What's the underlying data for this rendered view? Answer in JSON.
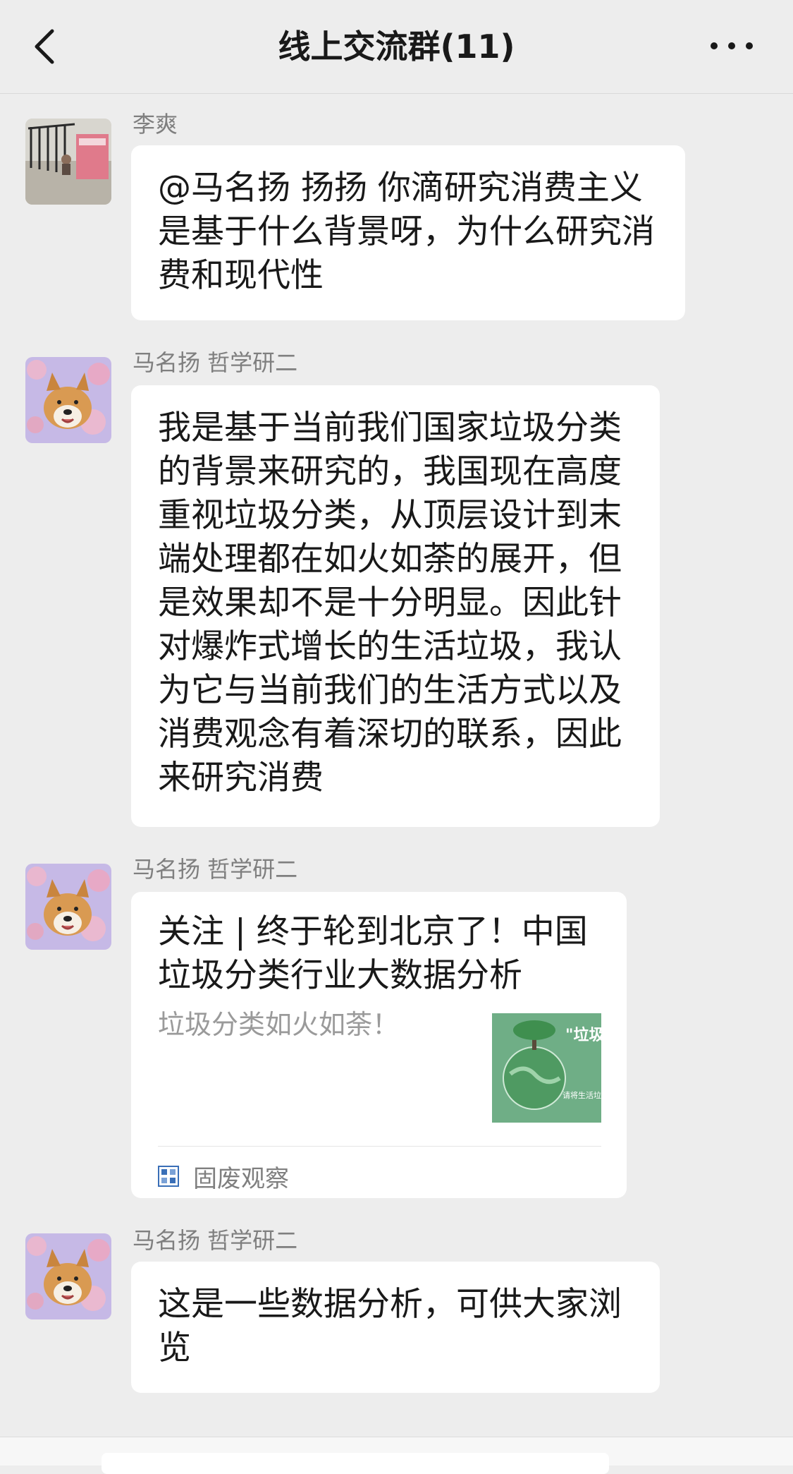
{
  "header": {
    "title": "线上交流群(11)"
  },
  "messages": [
    {
      "sender": "李爽",
      "text": "@马名扬  扬扬 你滴研究消费主义是基于什么背景呀，为什么研究消费和现代性"
    },
    {
      "sender": "马名扬  哲学研二",
      "text": "我是基于当前我们国家垃圾分类的背景来研究的，我国现在高度重视垃圾分类，从顶层设计到末端处理都在如火如荼的展开，但是效果却不是十分明显。因此针对爆炸式增长的生活垃圾，我认为它与当前我们的生活方式以及消费观念有着深切的联系，因此来研究消费"
    },
    {
      "sender": "马名扬  哲学研二",
      "card": {
        "title": "关注 | 终于轮到北京了！中国垃圾分类行业大数据分析",
        "description": "垃圾分类如火如荼！",
        "thumbnail_text": "\"垃圾分类",
        "thumbnail_subtext": "请将生活垃圾 做人指定位",
        "source_icon_text": "固废观察",
        "source_name": "固废观察"
      }
    },
    {
      "sender": "马名扬  哲学研二",
      "text": "这是一些数据分析，可供大家浏览"
    }
  ],
  "colors": {
    "background": "#ededed",
    "bubble": "#ffffff",
    "sender": "#7f7f7f",
    "text": "#191919"
  }
}
